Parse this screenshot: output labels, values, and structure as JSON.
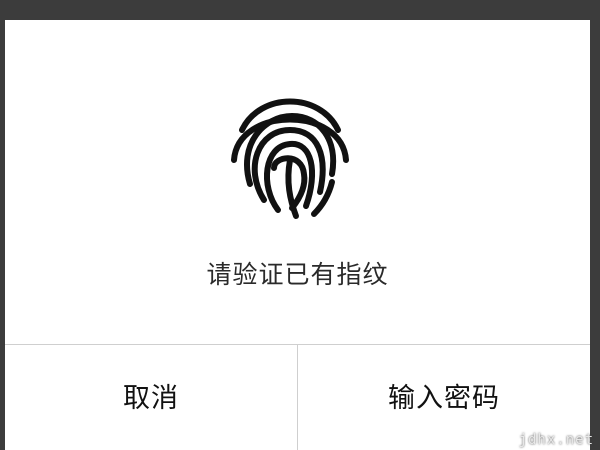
{
  "dialog": {
    "prompt": "请验证已有指纹",
    "icon": "fingerprint-icon",
    "cancel_label": "取消",
    "password_label": "输入密码"
  },
  "watermark": "jdhx.net",
  "colors": {
    "background": "#3c3c3c",
    "dialog_bg": "#ffffff",
    "text": "#111111",
    "divider": "#cfcfcf"
  }
}
